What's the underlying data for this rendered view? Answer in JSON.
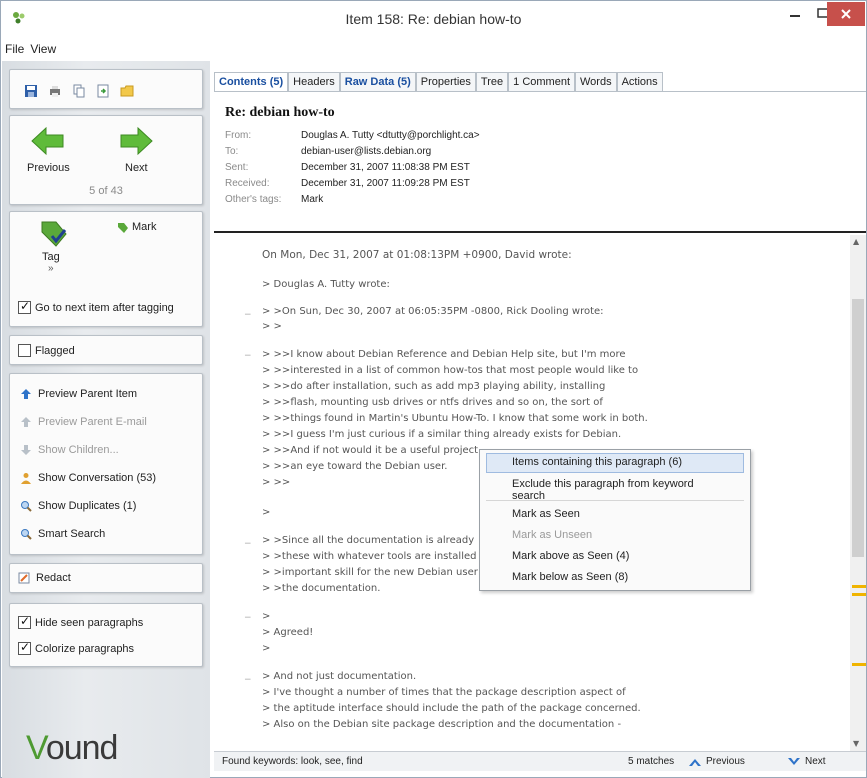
{
  "window": {
    "title": "Item 158: Re: debian how-to"
  },
  "menu": [
    "File",
    "View"
  ],
  "sidebar": {
    "navigation": {
      "previous_label": "Previous",
      "next_label": "Next",
      "position_text": "5 of 43"
    },
    "tagging": {
      "tag_label": "Tag",
      "mark_label": "Mark",
      "go_next_label": "Go to next item after tagging",
      "go_next_checked": true
    },
    "flagged": {
      "label": "Flagged",
      "checked": false
    },
    "actions": [
      {
        "label": "Preview Parent Item",
        "enabled": true,
        "icon": "arrow-up-icon"
      },
      {
        "label": "Preview Parent E-mail",
        "enabled": false,
        "icon": "arrow-up-icon"
      },
      {
        "label": "Show Children...",
        "enabled": false,
        "icon": "arrow-down-icon"
      },
      {
        "label": "Show Conversation (53)",
        "enabled": true,
        "icon": "person-icon"
      },
      {
        "label": "Show Duplicates (1)",
        "enabled": true,
        "icon": "magnifier-icon"
      },
      {
        "label": "Smart Search",
        "enabled": true,
        "icon": "magnifier-icon"
      }
    ],
    "redact_label": "Redact",
    "options": [
      {
        "label": "Hide seen paragraphs",
        "checked": true
      },
      {
        "label": "Colorize paragraphs",
        "checked": true
      }
    ],
    "logo": {
      "first": "V",
      "rest": "ound"
    }
  },
  "tabs": [
    {
      "label": "Contents (5)",
      "active": true
    },
    {
      "label": "Headers",
      "active": false
    },
    {
      "label": "Raw Data (5)",
      "active": false
    },
    {
      "label": "Properties",
      "active": false
    },
    {
      "label": "Tree",
      "active": false
    },
    {
      "label": "1 Comment",
      "active": false
    },
    {
      "label": "Words",
      "active": false
    },
    {
      "label": "Actions",
      "active": false
    }
  ],
  "message": {
    "subject": "Re: debian how-to",
    "headers": [
      {
        "key": "From:",
        "value": "Douglas A. Tutty <dtutty@porchlight.ca>"
      },
      {
        "key": "To:",
        "value": "debian-user@lists.debian.org"
      },
      {
        "key": "Sent:",
        "value": "December 31, 2007 11:08:38 PM EST"
      },
      {
        "key": "Received:",
        "value": "December 31, 2007 11:09:28 PM EST"
      },
      {
        "key": "Other's tags:",
        "value": "Mark"
      }
    ]
  },
  "body_lines": [
    "On Mon, Dec 31, 2007 at 01:08:13PM +0900, David wrote:",
    "> Douglas A. Tutty wrote:",
    "> >On Sun, Dec 30, 2007 at 06:05:35PM -0800, Rick Dooling wrote:",
    "> >",
    "> >>I know about Debian Reference and Debian Help site, but I'm more",
    "> >>interested in a list of common how-tos that most people would like to",
    "> >>do after installation, such as add mp3 playing ability, installing",
    "> >>flash, mounting usb drives or ntfs drives and so on, the sort of",
    "> >>things found in Martin's Ubuntu How-To. I know that some work in both.",
    "> >>I guess I'm just curious if a similar thing already exists for Debian.",
    "> >>And if not would it be a useful project",
    "> >>an eye toward the Debian user.",
    "> >>",
    ">",
    "> >Since all the documentation is already",
    "> >these with whatever tools are installed",
    "> >important skill for the new Debian user",
    "> >the documentation.",
    ">",
    "> Agreed!",
    ">",
    "> And not just documentation.",
    "> I've thought a number of times that the package description aspect of",
    "> the aptitude interface should include the path of the package concerned.",
    "> Also on the Debian site package description and the documentation -"
  ],
  "context_menu": [
    {
      "label": "Items containing this paragraph (6)",
      "enabled": true,
      "highlighted": true
    },
    {
      "label": "Exclude this paragraph from keyword search",
      "enabled": true,
      "highlighted": false
    },
    {
      "label": "Mark as Seen",
      "enabled": true,
      "highlighted": false
    },
    {
      "label": "Mark as Unseen",
      "enabled": false,
      "highlighted": false
    },
    {
      "label": "Mark above as Seen (4)",
      "enabled": true,
      "highlighted": false
    },
    {
      "label": "Mark below as Seen (8)",
      "enabled": true,
      "highlighted": false
    }
  ],
  "status_bar": {
    "found_keywords": "Found keywords: look, see, find",
    "matches": "5 matches",
    "previous_label": "Previous",
    "next_label": "Next"
  }
}
